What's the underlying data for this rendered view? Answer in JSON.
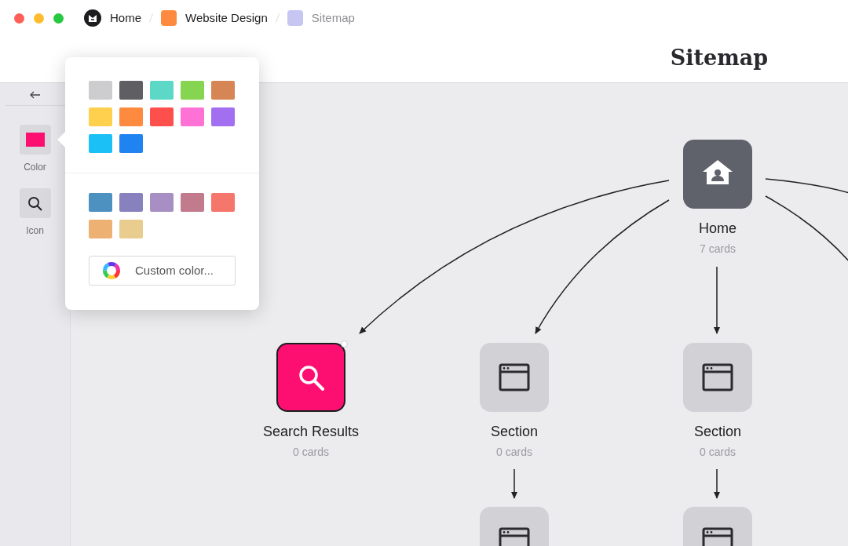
{
  "window": {
    "controls": [
      {
        "color": "#fe5f57"
      },
      {
        "color": "#febc2e"
      },
      {
        "color": "#28c840"
      }
    ]
  },
  "breadcrumbs": [
    {
      "label": "Home",
      "kind": "logo",
      "current": false
    },
    {
      "label": "Website Design",
      "kind": "square",
      "color": "#fd8a3e",
      "current": false
    },
    {
      "label": "Sitemap",
      "kind": "square",
      "color": "#c7c5f2",
      "current": true
    }
  ],
  "title": "Sitemap",
  "sidebar": {
    "tools": [
      {
        "label": "Color",
        "kind": "color",
        "color": "#fd0f72"
      },
      {
        "label": "Icon",
        "kind": "icon"
      }
    ]
  },
  "color_popover": {
    "groups": [
      {
        "swatches": [
          {
            "color": "#cdcdcf"
          },
          {
            "color": "#5f5e63"
          },
          {
            "color": "#5ed8c6"
          },
          {
            "color": "#85d551"
          },
          {
            "color": "#d68654"
          },
          {
            "color": "#fed04e"
          },
          {
            "color": "#fd8a3e"
          },
          {
            "color": "#fd4f4c"
          },
          {
            "color": "#fe72d5"
          },
          {
            "color": "#a16ff0"
          },
          {
            "color": "#1bc0f6"
          },
          {
            "color": "#1f84f1"
          }
        ]
      },
      {
        "swatches": [
          {
            "color": "#4d91c1"
          },
          {
            "color": "#8782bd"
          },
          {
            "color": "#a78fc3"
          },
          {
            "color": "#c27a8d"
          },
          {
            "color": "#f5766b"
          },
          {
            "color": "#eeb174"
          },
          {
            "color": "#e8cd8e"
          }
        ]
      }
    ],
    "custom_button": "Custom color..."
  },
  "nodes": [
    {
      "kind": "home",
      "title": "Home",
      "count": "7 cards",
      "color": "#5f616b",
      "selected": false
    },
    {
      "kind": "search",
      "title": "Search Results",
      "count": "0 cards",
      "color": "#fd0f72",
      "selected": true
    },
    {
      "kind": "section",
      "title": "Section",
      "count": "0 cards",
      "color": "#d2d2d6",
      "selected": false
    },
    {
      "kind": "section",
      "title": "Section",
      "count": "0 cards",
      "color": "#d2d2d6",
      "selected": false
    },
    {
      "kind": "section",
      "color": "#d2d2d6",
      "selected": false
    },
    {
      "kind": "section",
      "color": "#d2d2d6",
      "selected": false
    }
  ]
}
